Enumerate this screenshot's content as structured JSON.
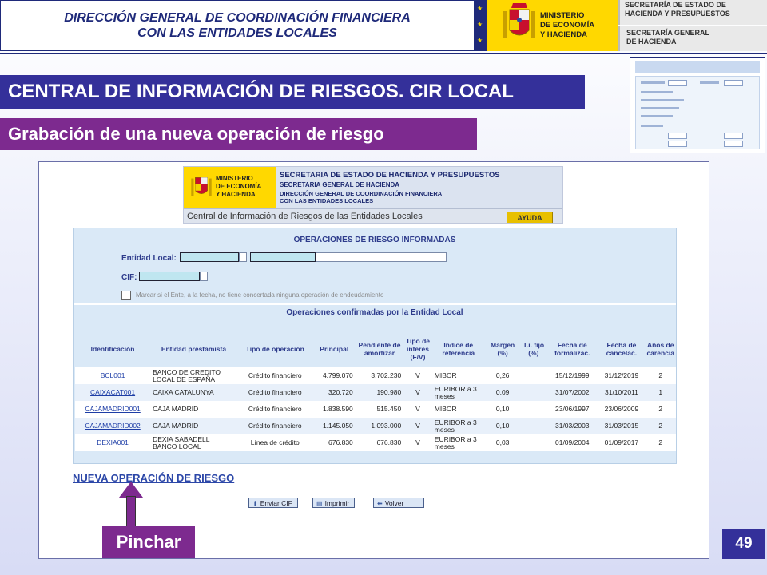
{
  "banner": {
    "org_line1": "DIRECCIÓN GENERAL DE COORDINACIÓN FINANCIERA",
    "org_line2": "CON LAS ENTIDADES LOCALES",
    "ministry_line1": "MINISTERIO",
    "ministry_line2": "DE ECONOMÍA",
    "ministry_line3": "Y HACIENDA",
    "secretary1_line1": "SECRETARÍA DE ESTADO DE",
    "secretary1_line2": "HACIENDA Y PRESUPUESTOS",
    "secretary2_line1": "SECRETARÍA GENERAL",
    "secretary2_line2": "DE HACIENDA"
  },
  "slide": {
    "title": "CENTRAL DE INFORMACIÓN DE RIESGOS. CIR LOCAL",
    "subtitle": "Grabación de una nueva operación de riesgo",
    "callout": "Pinchar",
    "page_number": "49"
  },
  "app": {
    "ministry_line1": "MINISTERIO",
    "ministry_line2": "DE ECONOMÍA",
    "ministry_line3": "Y HACIENDA",
    "header_line1": "SECRETARIA DE ESTADO DE HACIENDA Y PRESUPUESTOS",
    "header_line2": "SECRETARIA GENERAL DE HACIENDA",
    "header_line3": "DIRECCIÓN GENERAL DE COORDINACIÓN FINANCIERA",
    "header_line4": "CON LAS ENTIDADES LOCALES",
    "subtitle": "Central de Información de Riesgos de las Entidades Locales",
    "help_button": "AYUDA",
    "panel_title": "OPERACIONES DE RIESGO INFORMADAS",
    "entidad_label": "Entidad Local:",
    "cif_label": "CIF:",
    "checkbox_label": "Marcar si el Ente, a la fecha, no tiene concertada ninguna operación de endeudamiento",
    "confirmed_title": "Operaciones confirmadas por la Entidad Local",
    "new_operation_link": "NUEVA OPERACIÓN DE RIESGO",
    "buttons": {
      "send": "Enviar CIF",
      "print": "Imprimir",
      "back": "Volver"
    },
    "table": {
      "headers": [
        "Identificación",
        "Entidad prestamista",
        "Tipo de operación",
        "Principal",
        "Pendiente de amortizar",
        "Tipo de interés (F/V)",
        "Indice de referencia",
        "Margen (%)",
        "T.i. fijo (%)",
        "Fecha de formalizac.",
        "Fecha de cancelac.",
        "Años de carencia"
      ],
      "rows": [
        [
          "BCL001",
          "BANCO DE CREDITO LOCAL DE ESPAÑA",
          "Crédito financiero",
          "4.799.070",
          "3.702.230",
          "V",
          "MIBOR",
          "0,26",
          "",
          "15/12/1999",
          "31/12/2019",
          "2"
        ],
        [
          "CAIXACAT001",
          "CAIXA CATALUNYA",
          "Crédito financiero",
          "320.720",
          "190.980",
          "V",
          "EURIBOR a 3 meses",
          "0,09",
          "",
          "31/07/2002",
          "31/10/2011",
          "1"
        ],
        [
          "CAJAMADRID001",
          "CAJA MADRID",
          "Crédito financiero",
          "1.838.590",
          "515.450",
          "V",
          "MIBOR",
          "0,10",
          "",
          "23/06/1997",
          "23/06/2009",
          "2"
        ],
        [
          "CAJAMADRID002",
          "CAJA MADRID",
          "Crédito financiero",
          "1.145.050",
          "1.093.000",
          "V",
          "EURIBOR a 3 meses",
          "0,10",
          "",
          "31/03/2003",
          "31/03/2015",
          "2"
        ],
        [
          "DEXIA001",
          "DEXIA SABADELL BANCO LOCAL",
          "Línea de crédito",
          "676.830",
          "676.830",
          "V",
          "EURIBOR a 3 meses",
          "0,03",
          "",
          "01/09/2004",
          "01/09/2017",
          "2"
        ]
      ]
    }
  },
  "colors": {
    "navy": "#34309a",
    "purple": "#7d2a8f",
    "yellow": "#ffd800",
    "panel_blue": "#dae9f7"
  },
  "icons": {
    "coat_of_arms": "coat-of-arms-icon",
    "send": "arrow-up-icon",
    "print": "printer-icon",
    "back": "arrow-left-icon"
  }
}
